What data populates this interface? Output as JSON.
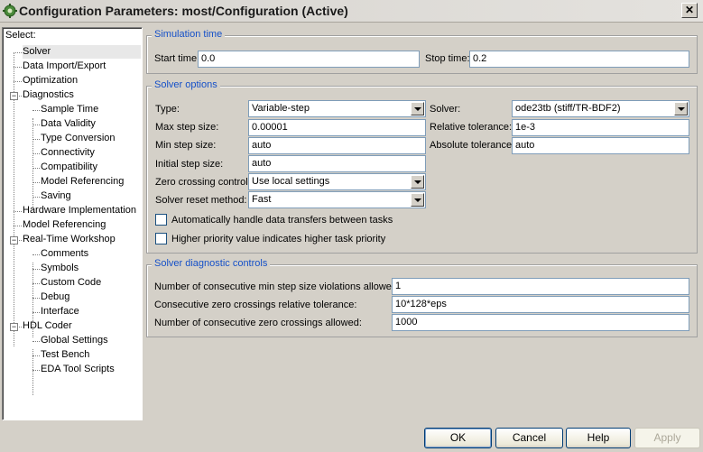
{
  "window": {
    "title": "Configuration Parameters: most/Configuration (Active)",
    "close_glyph": "✕",
    "icon": "gear-app-icon"
  },
  "tree": {
    "header": "Select:",
    "items": [
      {
        "label": "Solver",
        "selected": true
      },
      {
        "label": "Data Import/Export"
      },
      {
        "label": "Optimization"
      },
      {
        "label": "Diagnostics",
        "expander": "−"
      },
      {
        "label": "Sample Time"
      },
      {
        "label": "Data Validity"
      },
      {
        "label": "Type Conversion"
      },
      {
        "label": "Connectivity"
      },
      {
        "label": "Compatibility"
      },
      {
        "label": "Model Referencing"
      },
      {
        "label": "Saving"
      },
      {
        "label": "Hardware Implementation"
      },
      {
        "label": "Model Referencing"
      },
      {
        "label": "Real-Time Workshop",
        "expander": "−"
      },
      {
        "label": "Comments"
      },
      {
        "label": "Symbols"
      },
      {
        "label": "Custom Code"
      },
      {
        "label": "Debug"
      },
      {
        "label": "Interface"
      },
      {
        "label": "HDL Coder",
        "expander": "−"
      },
      {
        "label": "Global Settings"
      },
      {
        "label": "Test Bench"
      },
      {
        "label": "EDA Tool Scripts"
      }
    ]
  },
  "simulation_time": {
    "title": "Simulation time",
    "start_label": "Start time:",
    "start_value": "0.0",
    "stop_label": "Stop time:",
    "stop_value": "0.2"
  },
  "solver_options": {
    "title": "Solver options",
    "type_label": "Type:",
    "type_value": "Variable-step",
    "solver_label": "Solver:",
    "solver_value": "ode23tb (stiff/TR-BDF2)",
    "max_step_label": "Max step size:",
    "max_step_value": "0.00001",
    "rel_tol_label": "Relative tolerance:",
    "rel_tol_value": "1e-3",
    "min_step_label": "Min step size:",
    "min_step_value": "auto",
    "abs_tol_label": "Absolute tolerance:",
    "abs_tol_value": "auto",
    "init_step_label": "Initial step size:",
    "init_step_value": "auto",
    "zero_cross_label": "Zero crossing control:",
    "zero_cross_value": "Use local settings",
    "reset_label": "Solver reset method:",
    "reset_value": "Fast",
    "auto_transfer_label": "Automatically handle data transfers between tasks",
    "priority_label": "Higher priority value indicates higher task priority"
  },
  "diagnostic_controls": {
    "title": "Solver diagnostic controls",
    "min_step_viol_label": "Number of consecutive min step size violations allowed:",
    "min_step_viol_value": "1",
    "zc_rel_tol_label": "Consecutive zero crossings relative tolerance:",
    "zc_rel_tol_value": "10*128*eps",
    "zc_allowed_label": "Number of consecutive zero crossings allowed:",
    "zc_allowed_value": "1000"
  },
  "buttons": {
    "ok": "OK",
    "cancel": "Cancel",
    "help": "Help",
    "apply": "Apply"
  }
}
